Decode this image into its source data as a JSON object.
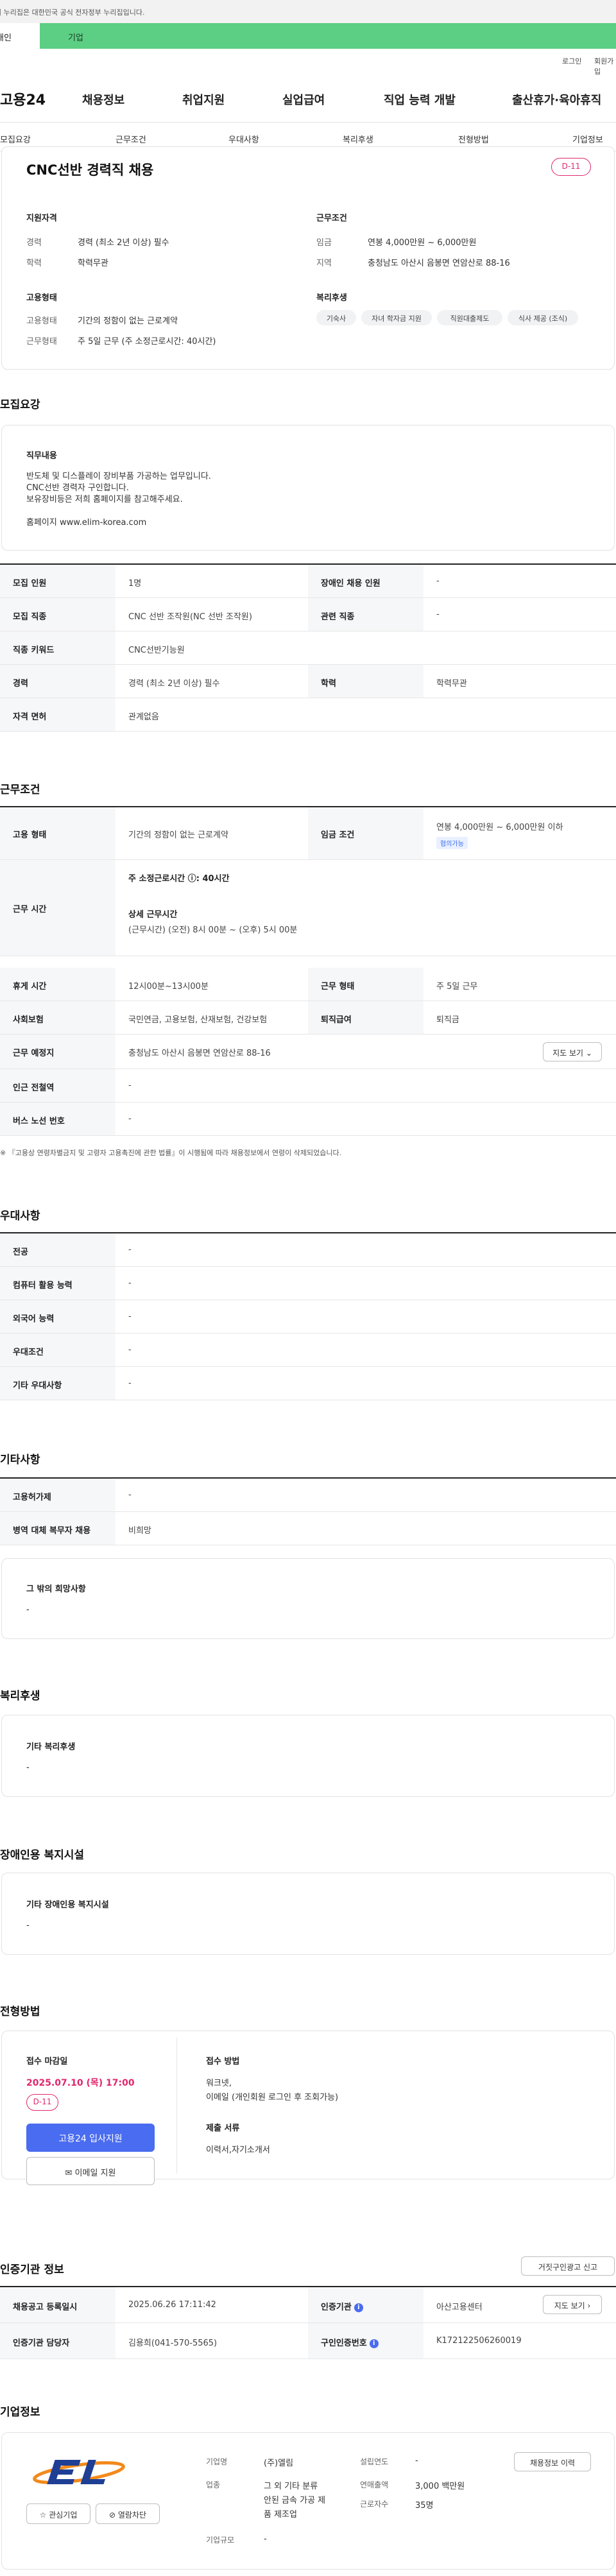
{
  "gov_banner": "이 누리집은 대한민국 공식 전자정부 누리집입니다.",
  "tabs": {
    "person": "개인",
    "company": "기업"
  },
  "util": {
    "login": "로그인",
    "join": "회원가입"
  },
  "logo": "고용24",
  "gnb": [
    "채용정보",
    "취업지원",
    "실업급여",
    "직업 능력 개발",
    "출산휴가·육아휴직"
  ],
  "lnb": [
    "모집요강",
    "근무조건",
    "우대사항",
    "복리후생",
    "전형방법",
    "기업정보"
  ],
  "summary": {
    "title": "CNC선반 경력직 채용",
    "dday": "D-11",
    "qualification_head": "지원자격",
    "career_label": "경력",
    "career_value": "경력 (최소 2년 이상) 필수",
    "edu_label": "학력",
    "edu_value": "학력무관",
    "condition_head": "근무조건",
    "wage_label": "임금",
    "wage_value": "연봉 4,000만원 ~ 6,000만원",
    "area_label": "지역",
    "area_value": "충청남도 아산시 음봉면 연암산로 88-16",
    "emp_head": "고용형태",
    "emptype_label": "고용형태",
    "emptype_value": "기간의 정함이 없는 근로계약",
    "worktype_label": "근무형태",
    "worktype_value": "주 5일 근무 (주 소정근로시간: 40시간)",
    "welfare_head": "복리후생",
    "welfare_chips": [
      "기숙사",
      "자녀 학자금 지원",
      "직원대출제도",
      "식사 제공 (조식)"
    ]
  },
  "recruit": {
    "section_title": "모집요강",
    "duty_head": "직무내용",
    "duty_lines": [
      "반도체 및 디스플레이 장비부품 가공하는 업무입니다.",
      "CNC선반 경력자 구인합니다.",
      "보유장비등은 저희 홈페이지를 참고해주세요."
    ],
    "homepage": "홈페이지 www.elim-korea.com",
    "rows": [
      {
        "l1": "모집 인원",
        "v1": "1명",
        "l2": "장애인 채용 인원",
        "v2": "-"
      },
      {
        "l1": "모집 직종",
        "v1": "CNC 선반 조작원(NC 선반 조작원)",
        "l2": "관련 직종",
        "v2": "-"
      },
      {
        "l1": "직종 키워드",
        "v1": "CNC선반기능원",
        "l2": "",
        "v2": ""
      },
      {
        "l1": "경력",
        "v1": "경력 (최소 2년 이상) 필수",
        "l2": "학력",
        "v2": "학력무관"
      },
      {
        "l1": "자격 면허",
        "v1": "관계없음",
        "l2": "",
        "v2": ""
      }
    ]
  },
  "work": {
    "section_title": "근무조건",
    "emp_label": "고용 형태",
    "emp_value": "기간의 정함이 없는 근로계약",
    "wage_label": "임금 조건",
    "wage_value": "연봉 4,000만원 ~ 6,000만원 이하",
    "wage_tag": "협의가능",
    "time_label": "근무 시간",
    "week_hours": "주 소정근로시간 ⓘ: 40시간",
    "detail_head": "상세 근무시간",
    "detail_value": "(근무시간) (오전) 8시 00분 ~ (오후) 5시 00분",
    "rest_label": "휴게 시간",
    "rest_value": "12시00분~13시00분",
    "form_label": "근무 형태",
    "form_value": "주 5일 근무",
    "insure_label": "사회보험",
    "insure_value": "국민연금, 고용보험, 산재보험, 건강보험",
    "severance_label": "퇴직급여",
    "severance_value": "퇴직금",
    "place_label": "근무 예정지",
    "place_value": "충청남도 아산시 음봉면 연암산로 88-16",
    "map_btn": "지도 보기 ⌄",
    "subway_label": "인근 전철역",
    "subway_value": "-",
    "bus_label": "버스 노선 번호",
    "bus_value": "-",
    "notice": "※ 『고용상 연령차별금지 및 고령자 고용촉진에 관한 법률』이 시행됨에 따라 채용정보에서 연령이 삭제되었습니다."
  },
  "prefer": {
    "section_title": "우대사항",
    "rows": [
      {
        "l": "전공",
        "v": "-"
      },
      {
        "l": "컴퓨터 활용 능력",
        "v": "-"
      },
      {
        "l": "외국어 능력",
        "v": "-"
      },
      {
        "l": "우대조건",
        "v": "-"
      },
      {
        "l": "기타 우대사항",
        "v": "-"
      }
    ]
  },
  "etc": {
    "section_title": "기타사항",
    "rows": [
      {
        "l": "고용허가제",
        "v": "-"
      },
      {
        "l": "병역 대체 복무자 채용",
        "v": "비희망"
      }
    ],
    "hope_head": "그 밖의 희망사항",
    "hope_value": "-"
  },
  "welfare": {
    "section_title": "복리후생",
    "head": "기타 복리후생",
    "value": "-"
  },
  "disabled": {
    "section_title": "장애인용 복지시설",
    "head": "기타 장애인용 복지시설",
    "value": "-"
  },
  "apply": {
    "section_title": "전형방법",
    "deadline_head": "접수 마감일",
    "deadline": "2025.07.10 (목) 17:00",
    "dday": "D-11",
    "apply_btn": "고용24 입사지원",
    "email_btn": "✉ 이메일 지원",
    "method_head": "접수 방법",
    "method_lines": [
      "워크넷,",
      "이메일 (개인회원 로그인 후 조회가능)"
    ],
    "docs_head": "제출 서류",
    "docs_value": "이력서,자기소개서"
  },
  "cert": {
    "section_title": "인증기관 정보",
    "report_btn": "거짓구인광고 신고",
    "reg_label": "채용공고 등록일시",
    "reg_value": "2025.06.26 17:11:42",
    "org_label": "인증기관",
    "org_value": "아산고용센터",
    "map_btn": "지도 보기 ›",
    "manager_label": "인증기관 담당자",
    "manager_value": "김용희(041-570-5565)",
    "num_label": "구인인증번호",
    "num_value": "K172122506260019"
  },
  "company": {
    "section_title": "기업정보",
    "logo_text": "EL",
    "fav_btn": "☆ 관심기업",
    "block_btn": "⊘ 열람차단",
    "name_label": "기업명",
    "name_value": "(주)엘림",
    "industry_label": "업종",
    "industry_lines": [
      "그 외 기타 분류",
      "안된 금속 가공 제",
      "품 제조업"
    ],
    "scale_label": "기업규모",
    "scale_value": "-",
    "est_label": "설립연도",
    "est_value": "-",
    "sales_label": "연매출액",
    "sales_value": "3,000 백만원",
    "staff_label": "근로자수",
    "staff_value": "35명",
    "info_btn": "채용정보 이력"
  },
  "colors": {
    "accent": "#4a6cf0",
    "dday": "#e0286e",
    "tab_company": "#5ccf84"
  }
}
